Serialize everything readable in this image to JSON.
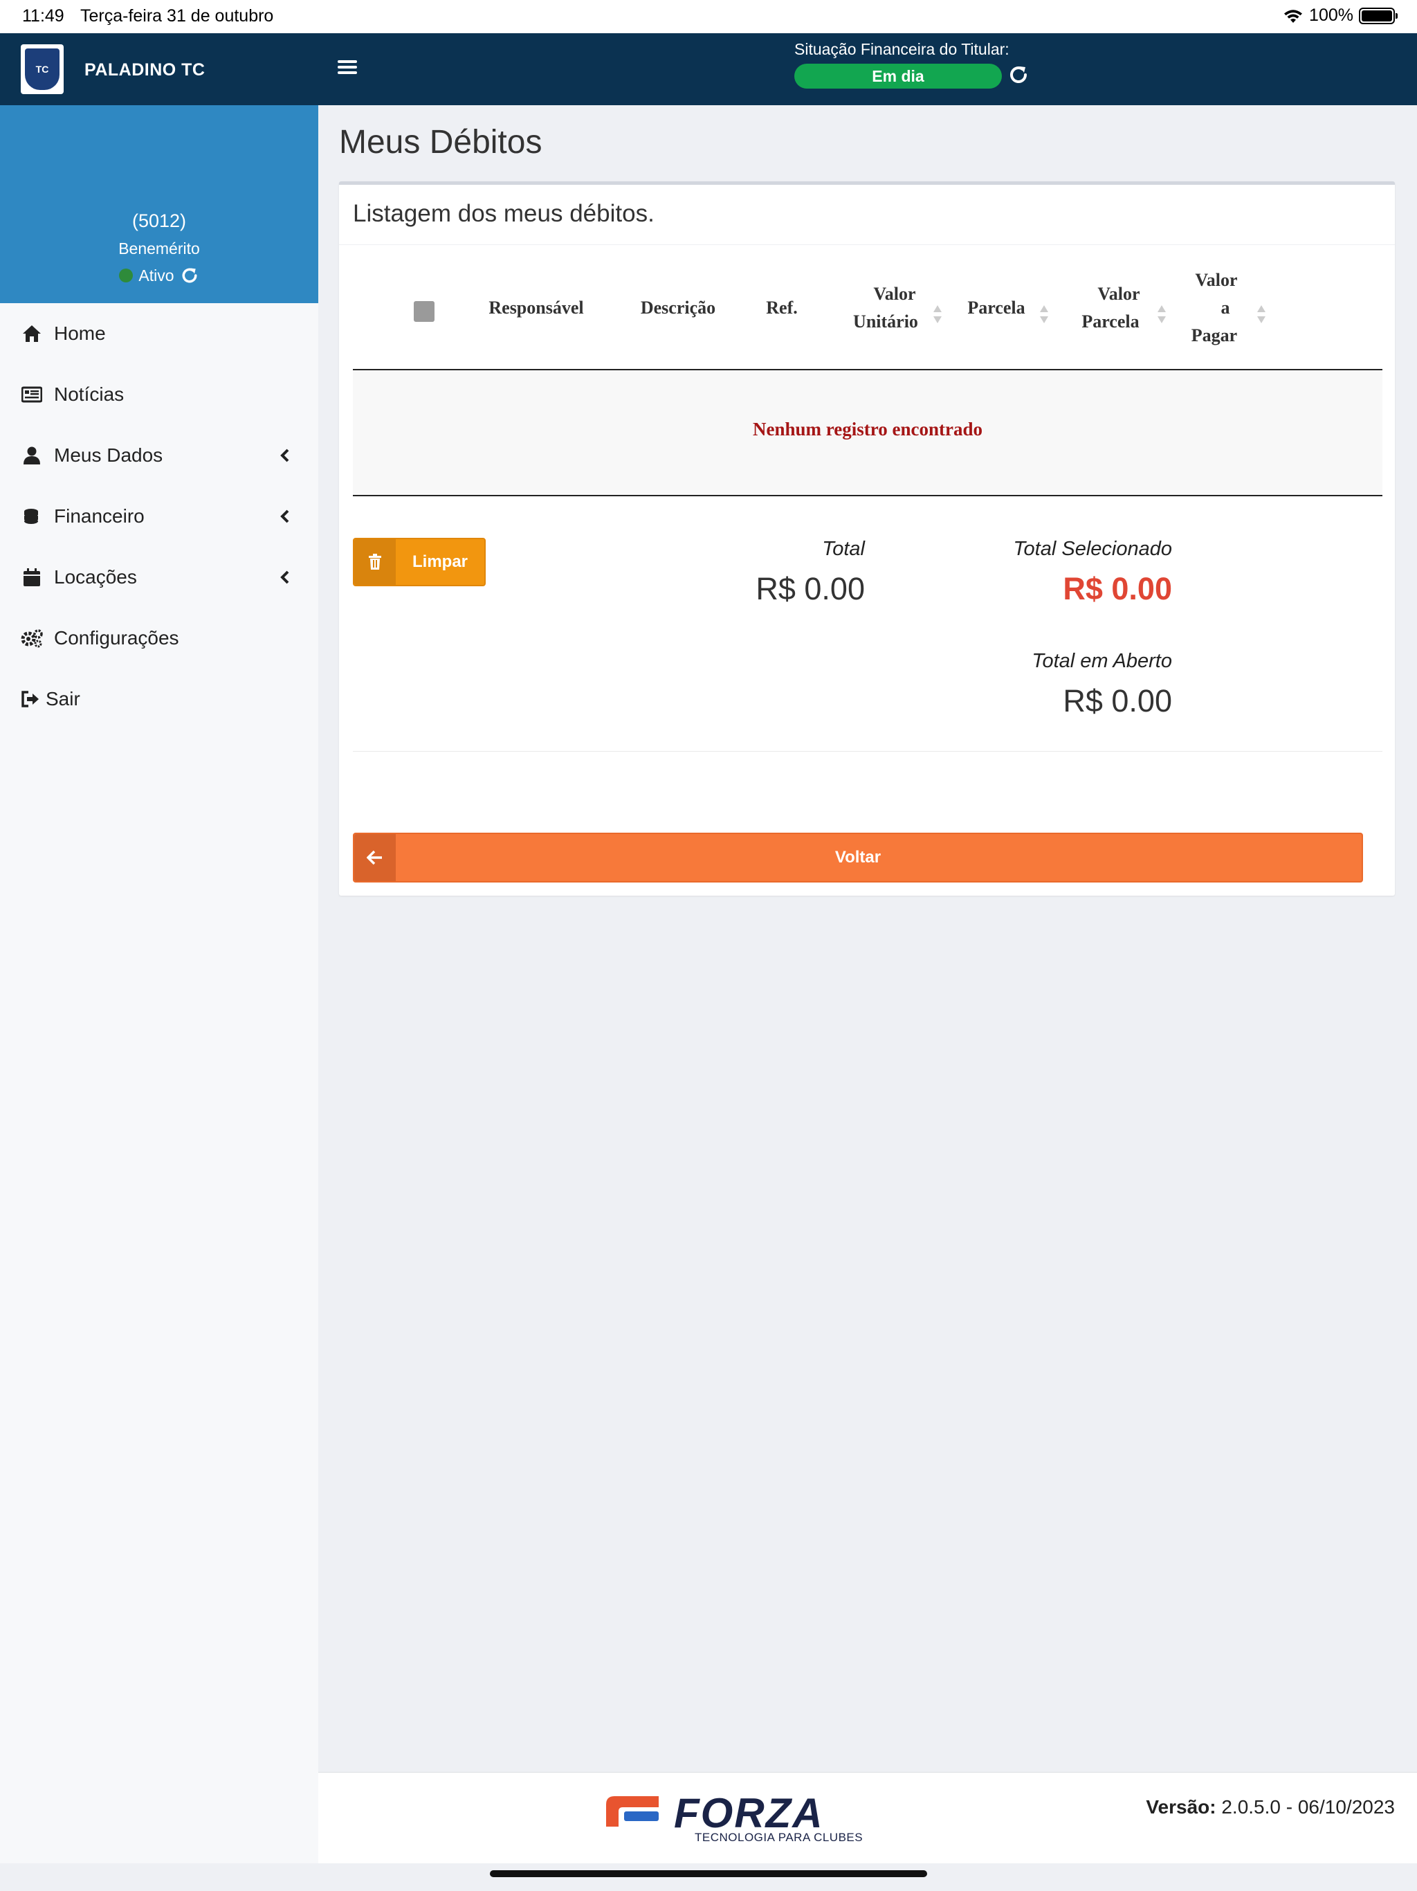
{
  "status_bar": {
    "time": "11:49",
    "date": "Terça-feira 31 de outubro",
    "battery": "100%"
  },
  "header": {
    "brand": "PALADINO TC",
    "financial_label": "Situação Financeira do Titular:",
    "financial_status": "Em dia",
    "status_color": "#12a650",
    "bg_color": "#0b3251"
  },
  "sidebar": {
    "user_code": "(5012)",
    "user_category": "Benemérito",
    "user_status": "Ativo",
    "items": [
      {
        "label": "Home",
        "icon": "home-icon"
      },
      {
        "label": "Notícias",
        "icon": "newspaper-icon"
      },
      {
        "label": "Meus Dados",
        "icon": "user-icon",
        "has_submenu": true
      },
      {
        "label": "Financeiro",
        "icon": "coins-icon",
        "has_submenu": true
      },
      {
        "label": "Locações",
        "icon": "calendar-icon",
        "has_submenu": true
      },
      {
        "label": "Configurações",
        "icon": "gears-icon"
      },
      {
        "label": "Sair",
        "icon": "sign-out-icon"
      }
    ]
  },
  "main": {
    "page_title": "Meus Débitos",
    "card_title": "Listagem dos meus débitos.",
    "table": {
      "columns": [
        {
          "line1": "Responsável"
        },
        {
          "line1": "Descrição"
        },
        {
          "line1": "Ref."
        },
        {
          "line1": "Valor",
          "line2": "Unitário"
        },
        {
          "line1": "Parcela"
        },
        {
          "line1": "Valor",
          "line2": "Parcela"
        },
        {
          "line1": "Valor",
          "line2": "a",
          "line3": "Pagar"
        }
      ],
      "empty_message": "Nenhum registro encontrado"
    },
    "clear_button": "Limpar",
    "totals": {
      "total_label": "Total",
      "total_value": "R$ 0.00",
      "selected_label": "Total Selecionado",
      "selected_value": "R$ 0.00",
      "open_label": "Total em Aberto",
      "open_value": "R$ 0.00"
    },
    "back_button": "Voltar"
  },
  "footer": {
    "logo_text": "FORZA",
    "logo_tagline": "TECNOLOGIA PARA CLUBES",
    "version_label": "Versão:",
    "version_value": "2.0.5.0 - 06/10/2023"
  }
}
